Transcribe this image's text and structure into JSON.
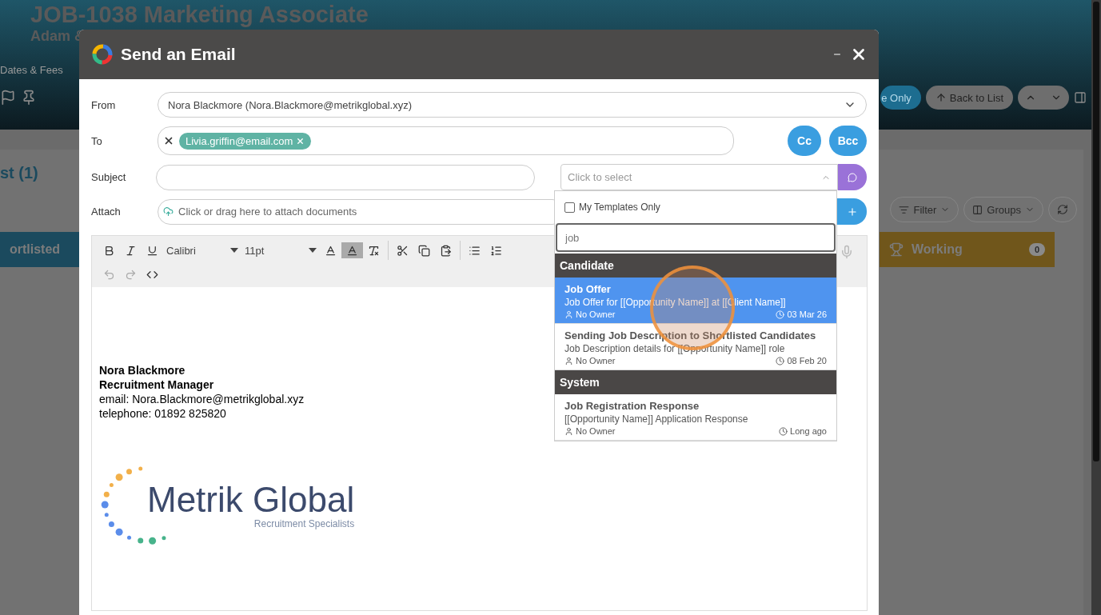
{
  "background": {
    "title": "JOB-1038 Marketing Associate",
    "subtitle": "Adam &",
    "tab": "Dates & Fees",
    "buttons": [
      {
        "label": "e Only",
        "kind": "primary"
      },
      {
        "label": "Back to List",
        "kind": "back"
      }
    ],
    "section_title": "st (1)",
    "tools": [
      "Filter",
      "Groups"
    ],
    "columns": [
      {
        "label": "ortlisted",
        "color": "#1b4a5e"
      },
      {
        "label": "Working",
        "count": "0",
        "color": "#70561b"
      }
    ]
  },
  "dialog": {
    "title": "Send an Email",
    "from": {
      "label": "From",
      "value": "Nora Blackmore (Nora.Blackmore@metrikglobal.xyz)"
    },
    "to": {
      "label": "To",
      "recipients": [
        "Livia.griffin@email.com"
      ]
    },
    "cc_button": "Cc",
    "bcc_button": "Bcc",
    "subject": {
      "label": "Subject"
    },
    "template_select": {
      "placeholder": "Click to select",
      "expanded": true
    },
    "attach": {
      "label": "Attach",
      "placeholder": "Click or drag here to attach documents"
    },
    "editor": {
      "font": "Calibri",
      "size": "11pt",
      "signature": [
        "Nora Blackmore",
        "Recruitment Manager",
        "email: Nora.Blackmore@metrikglobal.xyz",
        "telephone: 01892 825820"
      ],
      "logo": {
        "name": "Metrik Global",
        "tagline": "Recruitment Specialists"
      }
    }
  },
  "template_dropdown": {
    "my_templates_only": {
      "label": "My Templates Only",
      "checked": false
    },
    "search": "job",
    "groups": [
      {
        "name": "Candidate",
        "items": [
          {
            "title": "Job Offer",
            "description": "Job Offer for [[Opportunity Name]] at [[Client Name]]",
            "owner": "No Owner",
            "date": "03 Mar 26",
            "selected": true
          },
          {
            "title": "Sending Job Description to Shortlisted Candidates",
            "description": "Job Description details for [[Opportunity Name]] role",
            "owner": "No Owner",
            "date": "08 Feb 20",
            "selected": false
          }
        ]
      },
      {
        "name": "System",
        "items": [
          {
            "title": "Job Registration Response",
            "description": "[[Opportunity Name]] Application Response",
            "owner": "No Owner",
            "date": "Long ago",
            "selected": false
          }
        ]
      }
    ]
  }
}
